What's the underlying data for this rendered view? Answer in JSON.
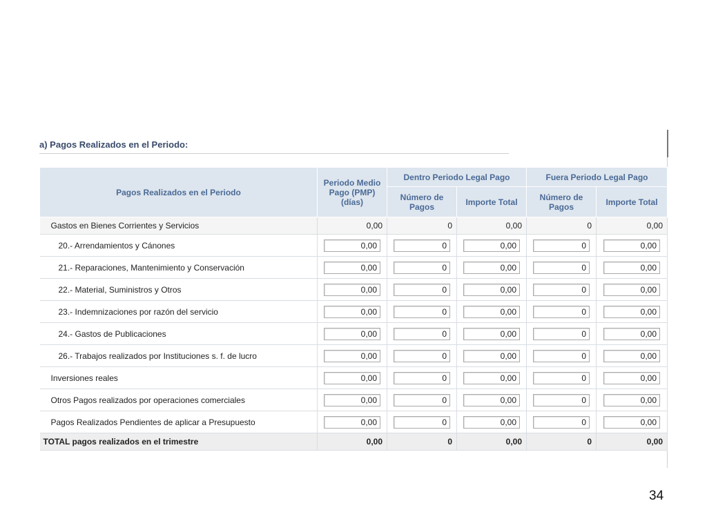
{
  "section": {
    "title": "a) Pagos Realizados en el Periodo:"
  },
  "table": {
    "header": {
      "col_label": "Pagos Realizados en el Periodo",
      "col_pmp": "Periodo Medio Pago (PMP) (días)",
      "group_dentro": "Dentro Periodo Legal Pago",
      "group_fuera": "Fuera Periodo Legal Pago",
      "num_pagos": "Número de Pagos",
      "importe_total": "Importe Total"
    },
    "rows": [
      {
        "label": "Gastos en Bienes Corrientes y Servicios",
        "pmp": "0,00",
        "dentro_num": "0",
        "dentro_importe": "0,00",
        "fuera_num": "0",
        "fuera_importe": "0,00"
      },
      {
        "label": "20.- Arrendamientos y Cánones",
        "pmp": "0,00",
        "dentro_num": "0",
        "dentro_importe": "0,00",
        "fuera_num": "0",
        "fuera_importe": "0,00"
      },
      {
        "label": "21.- Reparaciones, Mantenimiento y Conservación",
        "pmp": "0,00",
        "dentro_num": "0",
        "dentro_importe": "0,00",
        "fuera_num": "0",
        "fuera_importe": "0,00"
      },
      {
        "label": "22.- Material, Suministros y Otros",
        "pmp": "0,00",
        "dentro_num": "0",
        "dentro_importe": "0,00",
        "fuera_num": "0",
        "fuera_importe": "0,00"
      },
      {
        "label": "23.- Indemnizaciones por razón del servicio",
        "pmp": "0,00",
        "dentro_num": "0",
        "dentro_importe": "0,00",
        "fuera_num": "0",
        "fuera_importe": "0,00"
      },
      {
        "label": "24.- Gastos de Publicaciones",
        "pmp": "0,00",
        "dentro_num": "0",
        "dentro_importe": "0,00",
        "fuera_num": "0",
        "fuera_importe": "0,00"
      },
      {
        "label": "26.- Trabajos realizados por Instituciones s. f. de lucro",
        "pmp": "0,00",
        "dentro_num": "0",
        "dentro_importe": "0,00",
        "fuera_num": "0",
        "fuera_importe": "0,00"
      },
      {
        "label": "Inversiones reales",
        "pmp": "0,00",
        "dentro_num": "0",
        "dentro_importe": "0,00",
        "fuera_num": "0",
        "fuera_importe": "0,00"
      },
      {
        "label": "Otros Pagos realizados por operaciones comerciales",
        "pmp": "0,00",
        "dentro_num": "0",
        "dentro_importe": "0,00",
        "fuera_num": "0",
        "fuera_importe": "0,00"
      },
      {
        "label": "Pagos Realizados Pendientes de aplicar a Presupuesto",
        "pmp": "0,00",
        "dentro_num": "0",
        "dentro_importe": "0,00",
        "fuera_num": "0",
        "fuera_importe": "0,00"
      }
    ],
    "total": {
      "label": "TOTAL pagos realizados en el trimestre",
      "pmp": "0,00",
      "dentro_num": "0",
      "dentro_importe": "0,00",
      "fuera_num": "0",
      "fuera_importe": "0,00"
    }
  },
  "page": {
    "number": "34"
  }
}
